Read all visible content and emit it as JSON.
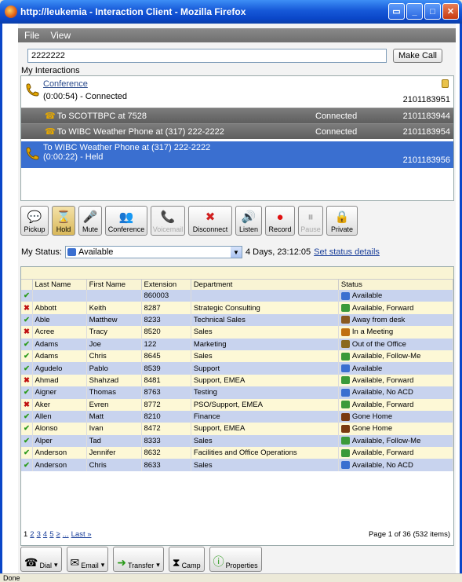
{
  "window": {
    "title": "http://leukemia - Interaction Client - Mozilla Firefox"
  },
  "menu": {
    "file": "File",
    "view": "View"
  },
  "dial": {
    "value": "2222222",
    "make_call": "Make Call"
  },
  "interactions": {
    "label": "My Interactions",
    "conference": {
      "title": "Conference",
      "status": "(0:00:54) - Connected",
      "id": "2101183951"
    },
    "legs": [
      {
        "label": "To SCOTTBPC at 7528",
        "state": "Connected",
        "id": "2101183944"
      },
      {
        "label": "To WIBC Weather Phone at (317) 222-2222",
        "state": "Connected",
        "id": "2101183954"
      }
    ],
    "held": {
      "label": "To WIBC Weather Phone at (317) 222-2222",
      "status": "(0:00:22) - Held",
      "id": "2101183956"
    }
  },
  "toolbar": {
    "pickup": "Pickup",
    "hold": "Hold",
    "mute": "Mute",
    "conference": "Conference",
    "voicemail": "Voicemail",
    "disconnect": "Disconnect",
    "listen": "Listen",
    "record": "Record",
    "pause": "Pause",
    "private": "Private"
  },
  "my_status": {
    "label": "My Status:",
    "value": "Available",
    "duration": "4 Days, 23:12:05",
    "details_link": "Set status details"
  },
  "directory": {
    "headers": [
      "",
      "Last Name",
      "First Name",
      "Extension",
      "Department",
      "Status"
    ],
    "rows": [
      {
        "ok": true,
        "last": "",
        "first": "",
        "ext": "860003",
        "dept": "",
        "status": "Available"
      },
      {
        "ok": false,
        "last": "Abbott",
        "first": "Keith",
        "ext": "8287",
        "dept": "Strategic Consulting",
        "status": "Available, Forward"
      },
      {
        "ok": true,
        "last": "Able",
        "first": "Matthew",
        "ext": "8233",
        "dept": "Technical Sales",
        "status": "Away from desk"
      },
      {
        "ok": false,
        "last": "Acree",
        "first": "Tracy",
        "ext": "8520",
        "dept": "Sales",
        "status": "In a Meeting"
      },
      {
        "ok": true,
        "last": "Adams",
        "first": "Joe",
        "ext": "122",
        "dept": "Marketing",
        "status": "Out of the Office"
      },
      {
        "ok": true,
        "last": "Adams",
        "first": "Chris",
        "ext": "8645",
        "dept": "Sales",
        "status": "Available, Follow-Me"
      },
      {
        "ok": true,
        "last": "Agudelo",
        "first": "Pablo",
        "ext": "8539",
        "dept": "Support",
        "status": "Available"
      },
      {
        "ok": false,
        "last": "Ahmad",
        "first": "Shahzad",
        "ext": "8481",
        "dept": "Support, EMEA",
        "status": "Available, Forward"
      },
      {
        "ok": true,
        "last": "Aigner",
        "first": "Thomas",
        "ext": "8763",
        "dept": "Testing",
        "status": "Available, No ACD"
      },
      {
        "ok": false,
        "last": "Aker",
        "first": "Evren",
        "ext": "8772",
        "dept": "PSO/Support, EMEA",
        "status": "Available, Forward"
      },
      {
        "ok": true,
        "last": "Allen",
        "first": "Matt",
        "ext": "8210",
        "dept": "Finance",
        "status": "Gone Home"
      },
      {
        "ok": true,
        "last": "Alonso",
        "first": "Ivan",
        "ext": "8472",
        "dept": "Support, EMEA",
        "status": "Gone Home"
      },
      {
        "ok": true,
        "last": "Alper",
        "first": "Tad",
        "ext": "8333",
        "dept": "Sales",
        "status": "Available, Follow-Me"
      },
      {
        "ok": true,
        "last": "Anderson",
        "first": "Jennifer",
        "ext": "8632",
        "dept": "Facilities and Office Operations",
        "status": "Available, Forward"
      },
      {
        "ok": true,
        "last": "Anderson",
        "first": "Chris",
        "ext": "8633",
        "dept": "Sales",
        "status": "Available, No ACD"
      }
    ],
    "pager": [
      "1",
      "2",
      "3",
      "4",
      "5",
      "≥",
      "...",
      "Last »"
    ],
    "page_info": "Page 1 of 36 (532 items)"
  },
  "bottom": {
    "dial": "Dial",
    "email": "Email",
    "transfer": "Transfer",
    "camp": "Camp",
    "properties": "Properties"
  },
  "statusbar": {
    "text": "Done"
  }
}
